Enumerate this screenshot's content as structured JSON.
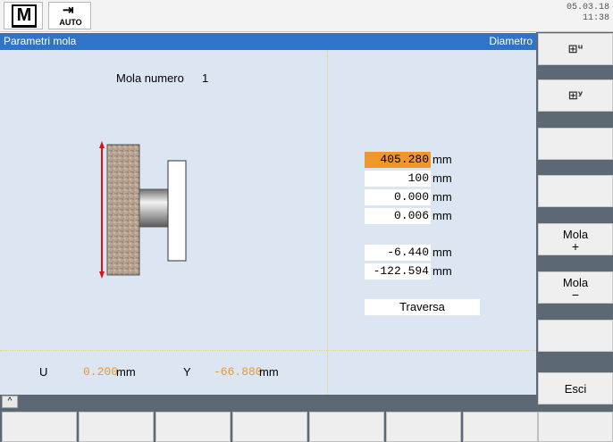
{
  "header": {
    "mode_machine_glyph": "M",
    "mode_auto_label": "AUTO",
    "date": "05.03.18",
    "time": "11:38"
  },
  "titlebar": {
    "title": "Parametri mola",
    "right_label": "Diametro"
  },
  "main": {
    "mola_label": "Mola numero",
    "mola_number": "1",
    "values": [
      {
        "value": "405.280",
        "unit": "mm",
        "selected": true
      },
      {
        "value": "100",
        "unit": "mm",
        "selected": false
      },
      {
        "value": "0.000",
        "unit": "mm",
        "selected": false
      },
      {
        "value": "0.006",
        "unit": "mm",
        "selected": false
      },
      {
        "value": "-6.440",
        "unit": "mm",
        "selected": false
      },
      {
        "value": "-122.594",
        "unit": "mm",
        "selected": false
      }
    ],
    "mode_field": "Traversa",
    "status": {
      "u_label": "U",
      "u_value": "0.200",
      "u_unit": "mm",
      "y_label": "Y",
      "y_value": "-66.880",
      "y_unit": "mm"
    },
    "colors": {
      "selection": "#f0962a",
      "background": "#dbe6f2",
      "title_bar": "#2f74c8"
    }
  },
  "softkeys_vertical": [
    {
      "label": "",
      "icon": "tool-u-icon"
    },
    {
      "label": "",
      "icon": "tool-y-icon"
    },
    {
      "label": "",
      "icon": ""
    },
    {
      "label": "",
      "icon": ""
    },
    {
      "label": "Mola",
      "sub": "+"
    },
    {
      "label": "Mola",
      "sub": "−"
    },
    {
      "label": "",
      "icon": ""
    },
    {
      "label": "Esci",
      "sub": ""
    }
  ],
  "scroll": {
    "up_glyph": "^"
  }
}
